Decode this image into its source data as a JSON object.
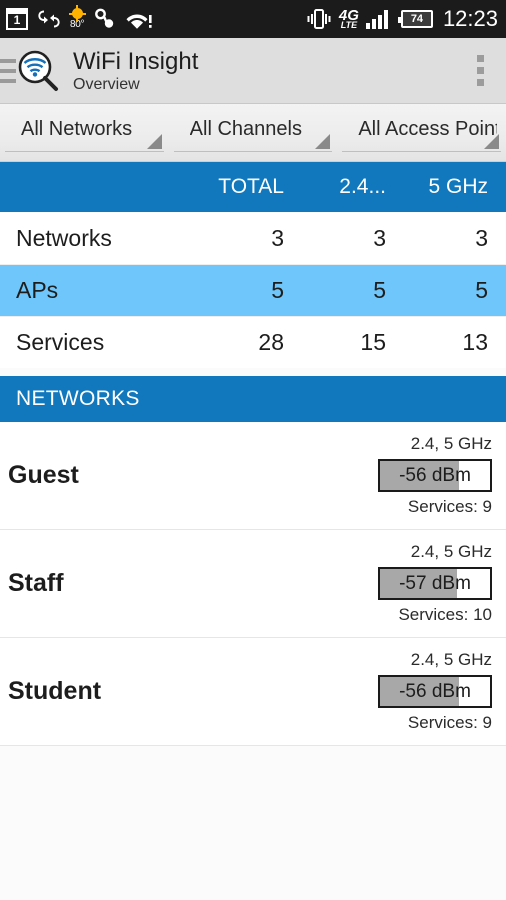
{
  "status_bar": {
    "sim_badge": "1",
    "sync_icon": "sync-icon",
    "temperature": "80°",
    "weather_icon": "sun-icon",
    "headset_icon": "headset-icon",
    "wifi_icon": "wifi-alert-icon",
    "vibrate_icon": "vibrate-icon",
    "network_type": "4G",
    "network_type_sub": "LTE",
    "signal_icon": "signal-bars-icon",
    "battery_level": "74",
    "time": "12:23"
  },
  "app_bar": {
    "drawer_icon": "hamburger-menu-icon",
    "logo_icon": "wifi-magnifier-logo",
    "title": "WiFi Insight",
    "subtitle": "Overview",
    "overflow_icon": "overflow-menu-icon"
  },
  "filters": [
    {
      "name": "network-filter",
      "label": "All Networks"
    },
    {
      "name": "channel-filter",
      "label": "All Channels"
    },
    {
      "name": "access-point-filter",
      "label": "All Access Points"
    }
  ],
  "summary_table": {
    "columns": [
      "",
      "TOTAL",
      "2.4...",
      "5 GHz"
    ],
    "rows": [
      {
        "label": "Networks",
        "total": "3",
        "band24": "3",
        "band5": "3",
        "highlighted": false
      },
      {
        "label": "APs",
        "total": "5",
        "band24": "5",
        "band5": "5",
        "highlighted": true
      },
      {
        "label": "Services",
        "total": "28",
        "band24": "15",
        "band5": "13",
        "highlighted": false
      }
    ]
  },
  "networks_section": {
    "header": "NETWORKS",
    "items": [
      {
        "name": "Guest",
        "bands": "2.4, 5 GHz",
        "signal": "-56 dBm",
        "signal_fill_pct": 72,
        "services": "Services:  9"
      },
      {
        "name": "Staff",
        "bands": "2.4, 5 GHz",
        "signal": "-57 dBm",
        "signal_fill_pct": 70,
        "services": "Services:  10"
      },
      {
        "name": "Student",
        "bands": "2.4, 5 GHz",
        "signal": "-56 dBm",
        "signal_fill_pct": 72,
        "services": "Services:  9"
      }
    ]
  },
  "colors": {
    "accent_blue": "#1278bd",
    "highlight_blue": "#6ec6fa",
    "status_bar_bg": "#1b1b1b",
    "app_bar_bg": "#dedede",
    "signal_fill": "#a8a8a8"
  }
}
